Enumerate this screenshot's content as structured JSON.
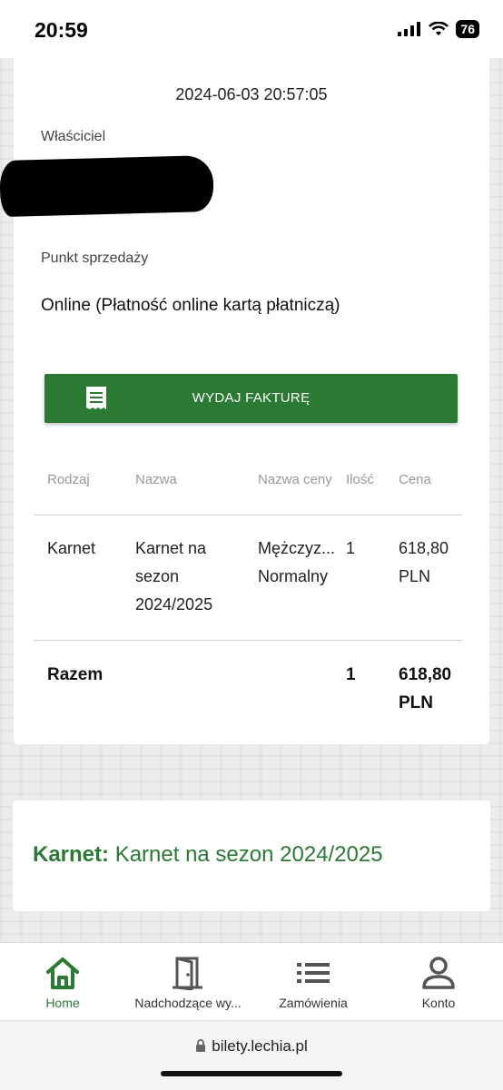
{
  "status_bar": {
    "time": "20:59",
    "battery": "76"
  },
  "order": {
    "datetime": "2024-06-03 20:57:05",
    "owner_label": "Właściciel",
    "sale_point_label": "Punkt sprzedaży",
    "sale_point_value": "Online (Płatność online kartą płatniczą)"
  },
  "invoice_button_label": "WYDAJ FAKTURĘ",
  "table": {
    "headers": [
      "Rodzaj",
      "Nazwa",
      "Nazwa ceny",
      "Ilość",
      "Cena"
    ],
    "row": {
      "type": "Karnet",
      "name_lines": [
        "Karnet na",
        "sezon",
        "2024/2025"
      ],
      "price_name_lines": [
        "Mężczyz...",
        "Normalny"
      ],
      "quantity": "1",
      "price_lines": [
        "618,80",
        "PLN"
      ]
    },
    "total": {
      "label": "Razem",
      "quantity": "1",
      "price_lines": [
        "618,80",
        "PLN"
      ]
    }
  },
  "summary": {
    "label": "Karnet:",
    "value": "Karnet na sezon 2024/2025"
  },
  "bottom_nav": [
    {
      "label": "Home",
      "icon": "home-icon",
      "active": true
    },
    {
      "label": "Nadchodzące wy...",
      "icon": "door-icon",
      "active": false
    },
    {
      "label": "Zamówienia",
      "icon": "list-icon",
      "active": false
    },
    {
      "label": "Konto",
      "icon": "user-icon",
      "active": false
    }
  ],
  "browser": {
    "url": "bilety.lechia.pl"
  },
  "colors": {
    "brand_green": "#2a7a34"
  }
}
